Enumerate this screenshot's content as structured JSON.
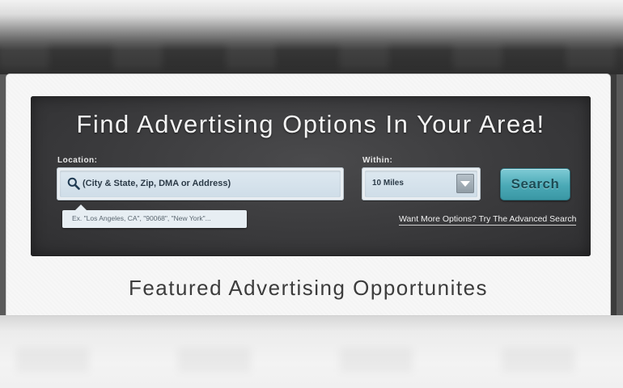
{
  "search_panel": {
    "title": "Find Advertising Options In Your Area!",
    "location_label": "Location:",
    "location_placeholder": "(City & State, Zip, DMA or Address)",
    "location_hint": "Ex. \"Los Angeles, CA\", \"90068\", \"New York\"...",
    "within_label": "Within:",
    "within_value": "10 Miles",
    "search_button": "Search",
    "advanced_link": "Want More Options? Try The Advanced Search"
  },
  "featured": {
    "title": "Featured Advertising Opportunites"
  },
  "colors": {
    "panel_bg": "#3a3a3c",
    "accent_button": "#4aa9b6",
    "input_bg": "#dde8f0"
  },
  "icons": [
    "search-icon",
    "chevron-down-icon"
  ]
}
